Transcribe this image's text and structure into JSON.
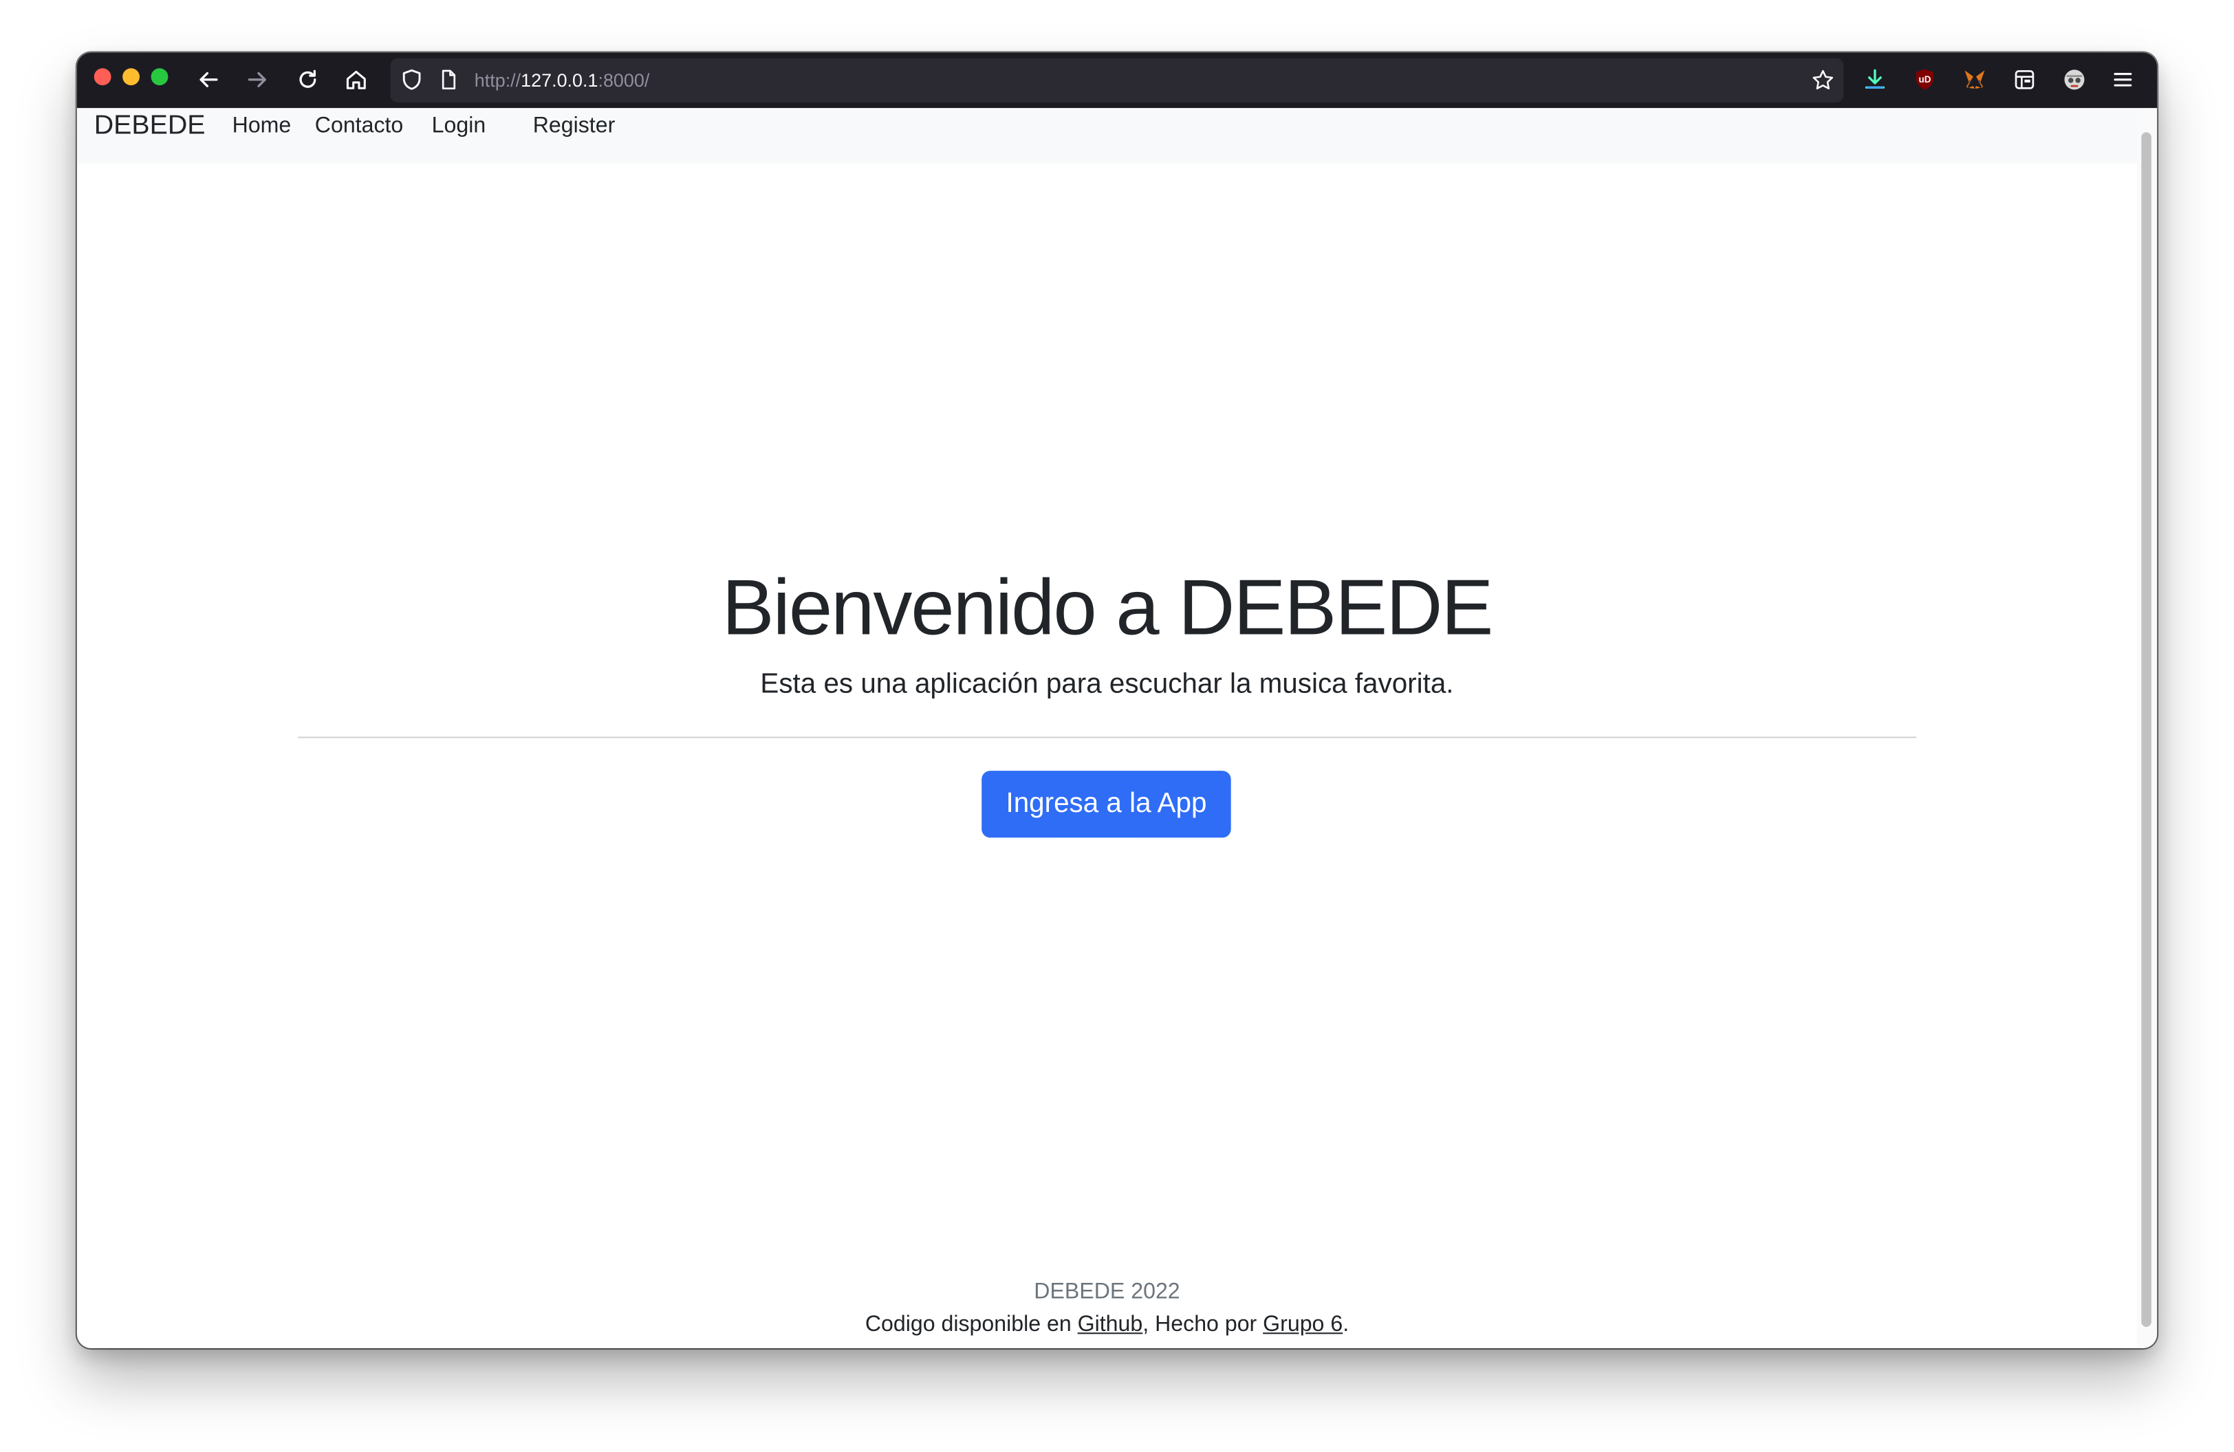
{
  "browser": {
    "url": {
      "scheme": "http://",
      "host": "127.0.0.1",
      "rest": ":8000/"
    },
    "colors": {
      "toolbar": "#1c1b22",
      "urlbar": "#2b2a33",
      "download_icon": "#54ffbd"
    },
    "icons": [
      "back-arrow-icon",
      "forward-arrow-icon",
      "reload-icon",
      "home-icon",
      "shield-icon",
      "page-icon",
      "star-icon",
      "download-icon",
      "ublock-icon",
      "metamask-icon",
      "reader-extension-icon",
      "profile-extension-icon",
      "hamburger-menu-icon"
    ],
    "extensions": {
      "ublock_label": "uD"
    }
  },
  "navbar": {
    "brand": "DEBEDE",
    "links": [
      "Home",
      "Contacto",
      "Login",
      "Register"
    ]
  },
  "hero": {
    "title": "Bienvenido a DEBEDE",
    "lead": "Esta es una aplicación para escuchar la musica favorita.",
    "button_label": "Ingresa a la App",
    "button_color": "#2f6df6"
  },
  "footer": {
    "year_line": "DEBEDE 2022",
    "credits_prefix": "Codigo disponible en ",
    "github_link": "Github",
    "credits_middle": ", Hecho por ",
    "group_link": "Grupo 6",
    "credits_suffix": "."
  }
}
